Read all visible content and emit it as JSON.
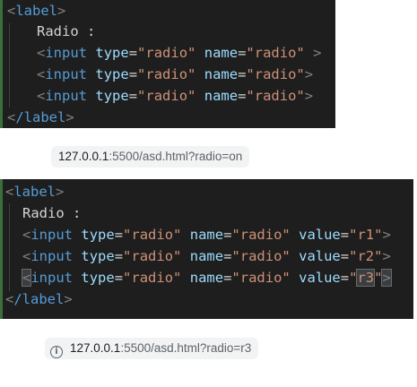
{
  "snippet1": {
    "open_tag": "label",
    "text": "Radio :",
    "inputs": [
      {
        "tag": "input",
        "type": "radio",
        "name": "radio",
        "trailing": " >"
      },
      {
        "tag": "input",
        "type": "radio",
        "name": "radio",
        "trailing": ">"
      },
      {
        "tag": "input",
        "type": "radio",
        "name": "radio",
        "trailing": ">"
      }
    ],
    "close_tag": "/label"
  },
  "url1": {
    "host": "127.0.0.1",
    "path": ":5500/asd.html?radio=on"
  },
  "snippet2": {
    "open_tag": "label",
    "text": "Radio :",
    "inputs": [
      {
        "tag": "input",
        "type": "radio",
        "name": "radio",
        "value": "r1"
      },
      {
        "tag": "input",
        "type": "radio",
        "name": "radio",
        "value": "r2"
      },
      {
        "tag": "input",
        "type": "radio",
        "name": "radio",
        "value": "r3"
      }
    ],
    "close_tag": "/label"
  },
  "url2": {
    "icon": "info-icon",
    "host": "127.0.0.1",
    "path": ":5500/asd.html?radio=r3"
  }
}
